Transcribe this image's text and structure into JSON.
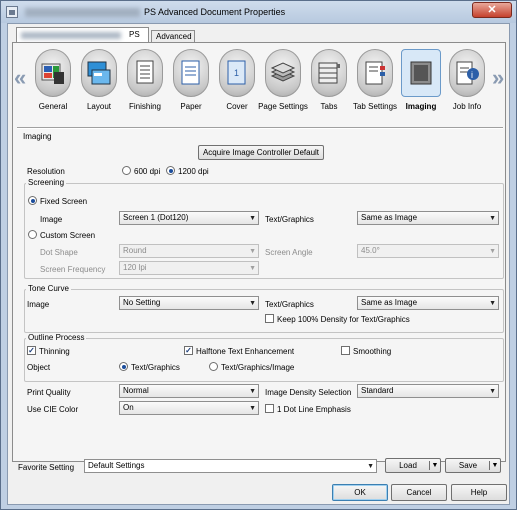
{
  "window": {
    "title": "PS Advanced Document Properties",
    "close_label": "✕"
  },
  "top_tabs": [
    {
      "label": "PS"
    },
    {
      "label": "Advanced"
    }
  ],
  "icon_tabs": [
    {
      "label": "General",
      "icon": "general-icon"
    },
    {
      "label": "Layout",
      "icon": "layout-icon"
    },
    {
      "label": "Finishing",
      "icon": "finishing-icon"
    },
    {
      "label": "Paper",
      "icon": "paper-icon"
    },
    {
      "label": "Cover",
      "icon": "cover-icon"
    },
    {
      "label": "Page Settings",
      "icon": "page-settings-icon"
    },
    {
      "label": "Tabs",
      "icon": "tabs-icon"
    },
    {
      "label": "Tab Settings",
      "icon": "tab-settings-icon"
    },
    {
      "label": "Imaging",
      "icon": "imaging-icon",
      "selected": true
    },
    {
      "label": "Job Info",
      "icon": "job-info-icon"
    }
  ],
  "nav": {
    "left": "«",
    "right": "»"
  },
  "imaging": {
    "section_title": "Imaging",
    "acquire_button": "Acquire Image Controller Default",
    "resolution_label": "Resolution",
    "res_600": "600 dpi",
    "res_1200": "1200 dpi",
    "resolution_selected": "1200 dpi"
  },
  "screening": {
    "title": "Screening",
    "fixed_screen": "Fixed Screen",
    "custom_screen": "Custom Screen",
    "image_label": "Image",
    "image_value": "Screen 1 (Dot120)",
    "textgraphics_label": "Text/Graphics",
    "textgraphics_value": "Same as Image",
    "dot_shape_label": "Dot Shape",
    "dot_shape_value": "Round",
    "screen_angle_label": "Screen Angle",
    "screen_angle_value": "45.0°",
    "screen_freq_label": "Screen Frequency",
    "screen_freq_value": "120 lpi"
  },
  "tone_curve": {
    "title": "Tone Curve",
    "image_label": "Image",
    "image_value": "No Setting",
    "textgraphics_label": "Text/Graphics",
    "textgraphics_value": "Same as Image",
    "keep_density": "Keep 100% Density for Text/Graphics"
  },
  "outline": {
    "title": "Outline Process",
    "thinning": "Thinning",
    "halftone": "Halftone Text Enhancement",
    "smoothing": "Smoothing",
    "object_label": "Object",
    "obj_textgraphics": "Text/Graphics",
    "obj_textgraphicsimage": "Text/Graphics/Image"
  },
  "quality": {
    "print_quality_label": "Print Quality",
    "print_quality_value": "Normal",
    "image_density_label": "Image Density Selection",
    "image_density_value": "Standard",
    "use_cie_label": "Use CIE Color",
    "use_cie_value": "On",
    "dot_line": "1 Dot Line Emphasis"
  },
  "favorite": {
    "label": "Favorite Setting",
    "value": "Default Settings",
    "load": "Load",
    "save": "Save"
  },
  "footer": {
    "ok": "OK",
    "cancel": "Cancel",
    "help": "Help"
  },
  "colors": {
    "accent": "#1b4d9c",
    "frame": "#bfcfe3",
    "close": "#c5412d"
  }
}
